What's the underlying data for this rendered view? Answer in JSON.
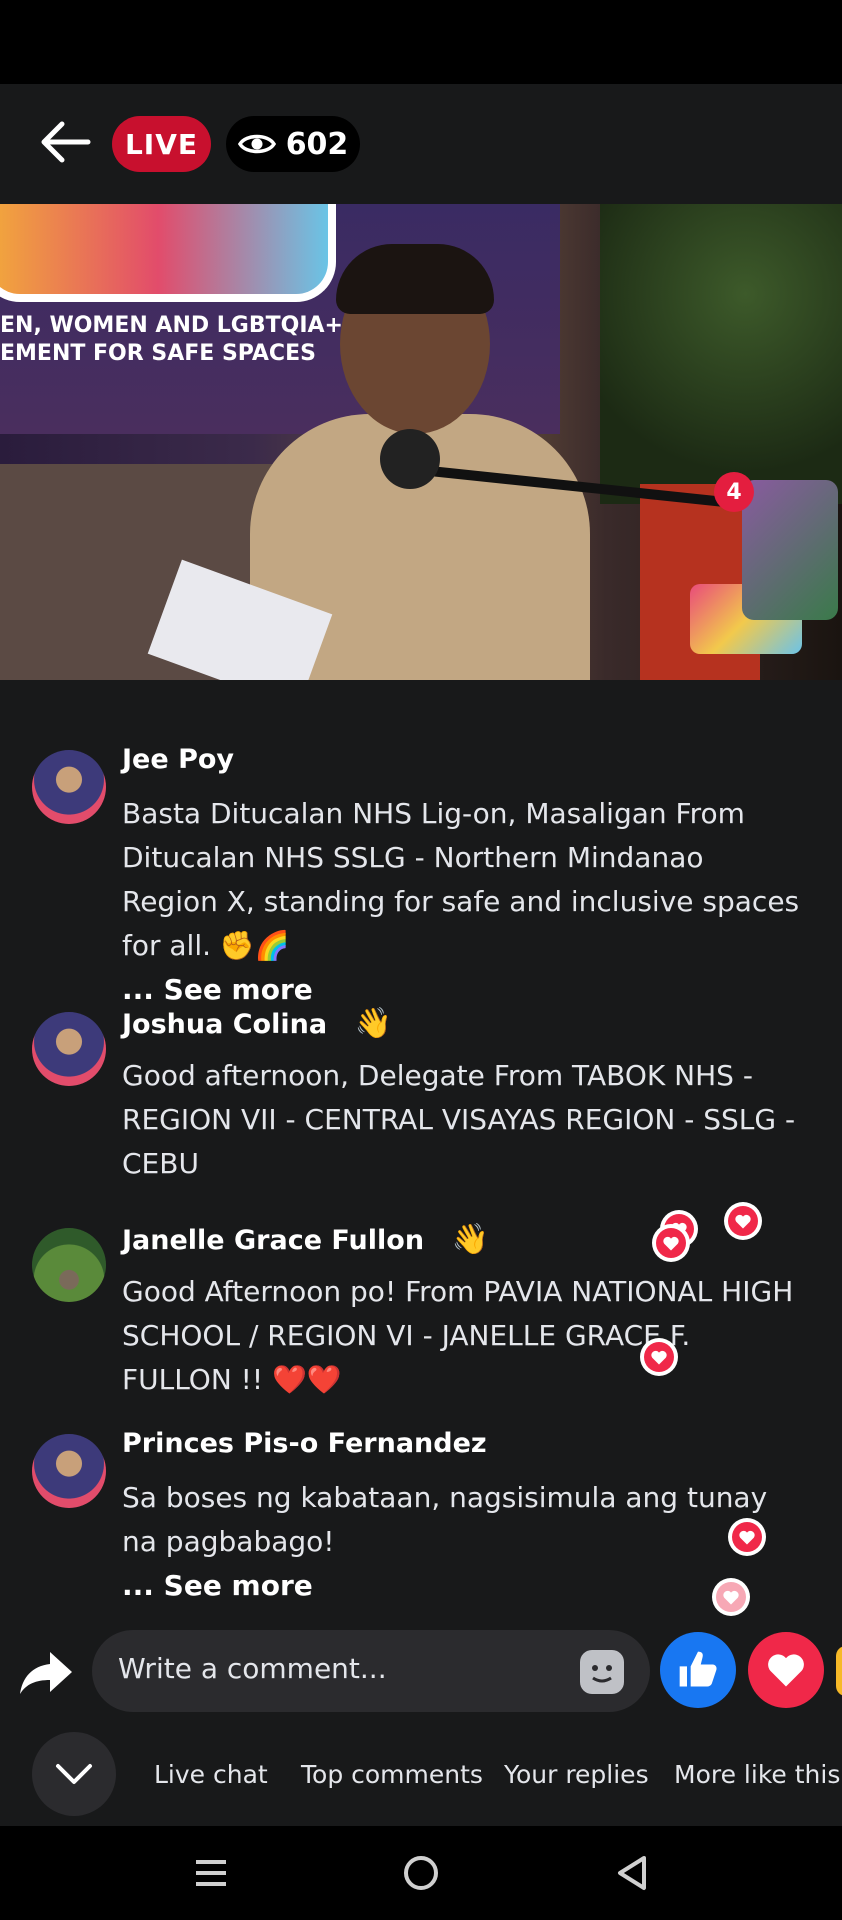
{
  "header": {
    "live_label": "LIVE",
    "viewer_count": "602"
  },
  "video": {
    "banner_line1": "EN, WOMEN AND LGBTQIA+",
    "banner_line2": "EMENT FOR SAFE SPACES",
    "thumbnail_count": "4"
  },
  "comments": [
    {
      "name": "Jee Poy",
      "text": "Basta Ditucalan NHS Lig-on, Masaligan From Ditucalan NHS SSLG - Northern Mindanao Region X, standing for safe and inclusive spaces for all. ✊🌈",
      "see_more": "... See more",
      "wave": ""
    },
    {
      "name": "Joshua Colina",
      "text": "Good afternoon, Delegate From TABOK NHS - REGION VII - CENTRAL VISAYAS REGION - SSLG - CEBU",
      "see_more": "",
      "wave": "👋"
    },
    {
      "name": "Janelle Grace Fullon",
      "text": "Good Afternoon po! From PAVIA NATIONAL HIGH SCHOOL / REGION VI - JANELLE GRACE F. FULLON !! ❤️❤️",
      "see_more": "",
      "wave": "👋"
    },
    {
      "name": "Princes Pis-o Fernandez",
      "text": "Sa boses ng kabataan, nagsisimula ang tunay na pagbabago!",
      "see_more": "... See more",
      "wave": ""
    }
  ],
  "composer": {
    "placeholder": "Write a comment..."
  },
  "tabs": [
    "Live chat",
    "Top comments",
    "Your replies",
    "More like this"
  ],
  "colors": {
    "live_red": "#c8102e",
    "like_blue": "#1877f2",
    "love_red": "#f02849",
    "background": "#18191a"
  },
  "icons": {
    "back": "arrow-left-icon",
    "viewers": "eye-icon",
    "share": "share-arrow-icon",
    "sticker": "sticker-icon",
    "like": "thumbs-up-icon",
    "love": "heart-icon",
    "collapse": "chevron-down-icon",
    "nav": [
      "menu-icon",
      "home-circle-icon",
      "back-triangle-icon"
    ]
  }
}
